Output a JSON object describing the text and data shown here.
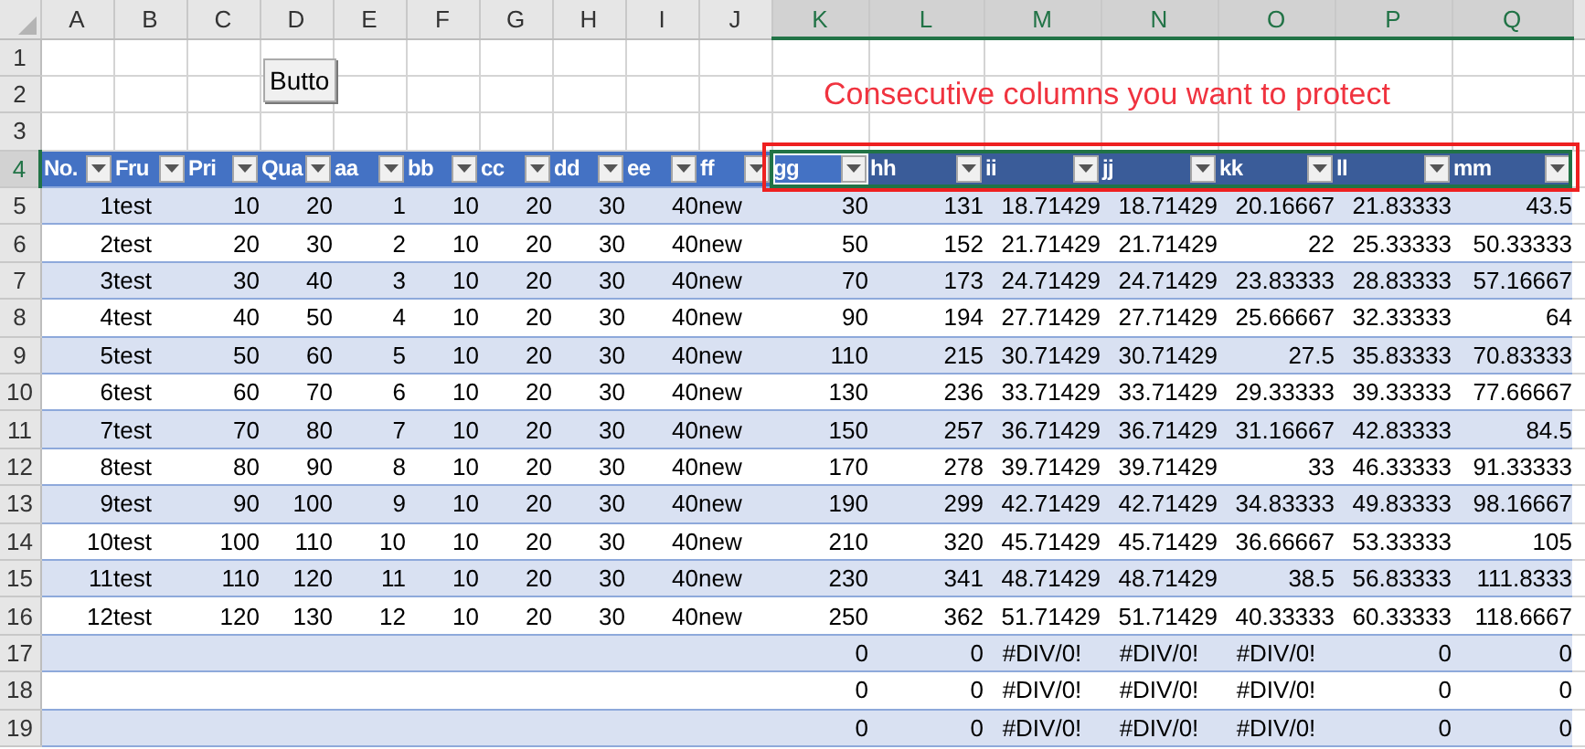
{
  "sheet": {
    "columns": [
      {
        "label": "A",
        "selected": false
      },
      {
        "label": "B",
        "selected": false
      },
      {
        "label": "C",
        "selected": false
      },
      {
        "label": "D",
        "selected": false
      },
      {
        "label": "E",
        "selected": false
      },
      {
        "label": "F",
        "selected": false
      },
      {
        "label": "G",
        "selected": false
      },
      {
        "label": "H",
        "selected": false
      },
      {
        "label": "I",
        "selected": false
      },
      {
        "label": "J",
        "selected": false
      },
      {
        "label": "K",
        "selected": true
      },
      {
        "label": "L",
        "selected": true
      },
      {
        "label": "M",
        "selected": true
      },
      {
        "label": "N",
        "selected": true
      },
      {
        "label": "O",
        "selected": true
      },
      {
        "label": "P",
        "selected": true
      },
      {
        "label": "Q",
        "selected": true
      }
    ],
    "row_headers": [
      {
        "label": "1",
        "selected": false
      },
      {
        "label": "2",
        "selected": false
      },
      {
        "label": "3",
        "selected": false
      },
      {
        "label": "4",
        "selected": true
      },
      {
        "label": "5",
        "selected": false
      },
      {
        "label": "6",
        "selected": false
      },
      {
        "label": "7",
        "selected": false
      },
      {
        "label": "8",
        "selected": false
      },
      {
        "label": "9",
        "selected": false
      },
      {
        "label": "10",
        "selected": false
      },
      {
        "label": "11",
        "selected": false
      },
      {
        "label": "12",
        "selected": false
      },
      {
        "label": "13",
        "selected": false
      },
      {
        "label": "14",
        "selected": false
      },
      {
        "label": "15",
        "selected": false
      },
      {
        "label": "16",
        "selected": false
      },
      {
        "label": "17",
        "selected": false
      },
      {
        "label": "18",
        "selected": false
      },
      {
        "label": "19",
        "selected": false
      }
    ],
    "button": {
      "label": "Butto"
    },
    "note": {
      "text": "Consecutive columns you want to protect"
    },
    "table": {
      "header": [
        {
          "label": "No.",
          "selected": false
        },
        {
          "label": "Fru",
          "selected": false
        },
        {
          "label": "Pri",
          "selected": false
        },
        {
          "label": "Qua",
          "selected": false
        },
        {
          "label": "aa",
          "selected": false
        },
        {
          "label": "bb",
          "selected": false
        },
        {
          "label": "cc",
          "selected": false
        },
        {
          "label": "dd",
          "selected": false
        },
        {
          "label": "ee",
          "selected": false
        },
        {
          "label": "ff",
          "selected": false
        },
        {
          "label": "gg",
          "selected": true
        },
        {
          "label": "hh",
          "selected": true
        },
        {
          "label": "ii",
          "selected": true
        },
        {
          "label": "jj",
          "selected": true
        },
        {
          "label": "kk",
          "selected": true
        },
        {
          "label": "ll",
          "selected": true
        },
        {
          "label": "mm",
          "selected": true
        }
      ],
      "rows": [
        [
          "1",
          "test",
          "10",
          "20",
          "1",
          "10",
          "20",
          "30",
          "40",
          "new",
          "30",
          "131",
          "18.71429",
          "18.71429",
          "20.16667",
          "21.83333",
          "43.5"
        ],
        [
          "2",
          "test",
          "20",
          "30",
          "2",
          "10",
          "20",
          "30",
          "40",
          "new",
          "50",
          "152",
          "21.71429",
          "21.71429",
          "22",
          "25.33333",
          "50.33333"
        ],
        [
          "3",
          "test",
          "30",
          "40",
          "3",
          "10",
          "20",
          "30",
          "40",
          "new",
          "70",
          "173",
          "24.71429",
          "24.71429",
          "23.83333",
          "28.83333",
          "57.16667"
        ],
        [
          "4",
          "test",
          "40",
          "50",
          "4",
          "10",
          "20",
          "30",
          "40",
          "new",
          "90",
          "194",
          "27.71429",
          "27.71429",
          "25.66667",
          "32.33333",
          "64"
        ],
        [
          "5",
          "test",
          "50",
          "60",
          "5",
          "10",
          "20",
          "30",
          "40",
          "new",
          "110",
          "215",
          "30.71429",
          "30.71429",
          "27.5",
          "35.83333",
          "70.83333"
        ],
        [
          "6",
          "test",
          "60",
          "70",
          "6",
          "10",
          "20",
          "30",
          "40",
          "new",
          "130",
          "236",
          "33.71429",
          "33.71429",
          "29.33333",
          "39.33333",
          "77.66667"
        ],
        [
          "7",
          "test",
          "70",
          "80",
          "7",
          "10",
          "20",
          "30",
          "40",
          "new",
          "150",
          "257",
          "36.71429",
          "36.71429",
          "31.16667",
          "42.83333",
          "84.5"
        ],
        [
          "8",
          "test",
          "80",
          "90",
          "8",
          "10",
          "20",
          "30",
          "40",
          "new",
          "170",
          "278",
          "39.71429",
          "39.71429",
          "33",
          "46.33333",
          "91.33333"
        ],
        [
          "9",
          "test",
          "90",
          "100",
          "9",
          "10",
          "20",
          "30",
          "40",
          "new",
          "190",
          "299",
          "42.71429",
          "42.71429",
          "34.83333",
          "49.83333",
          "98.16667"
        ],
        [
          "10",
          "test",
          "100",
          "110",
          "10",
          "10",
          "20",
          "30",
          "40",
          "new",
          "210",
          "320",
          "45.71429",
          "45.71429",
          "36.66667",
          "53.33333",
          "105"
        ],
        [
          "11",
          "test",
          "110",
          "120",
          "11",
          "10",
          "20",
          "30",
          "40",
          "new",
          "230",
          "341",
          "48.71429",
          "48.71429",
          "38.5",
          "56.83333",
          "111.8333"
        ],
        [
          "12",
          "test",
          "120",
          "130",
          "12",
          "10",
          "20",
          "30",
          "40",
          "new",
          "250",
          "362",
          "51.71429",
          "51.71429",
          "40.33333",
          "60.33333",
          "118.6667"
        ],
        [
          null,
          null,
          null,
          null,
          null,
          null,
          null,
          null,
          null,
          null,
          "0",
          "0",
          {
            "text": "#DIV/0!",
            "kind": "error"
          },
          {
            "text": "#DIV/0!",
            "kind": "error"
          },
          {
            "text": "#DIV/0!",
            "kind": "error"
          },
          "0",
          "0"
        ],
        [
          null,
          null,
          null,
          null,
          null,
          null,
          null,
          null,
          null,
          null,
          "0",
          "0",
          {
            "text": "#DIV/0!",
            "kind": "error"
          },
          {
            "text": "#DIV/0!",
            "kind": "error"
          },
          {
            "text": "#DIV/0!",
            "kind": "error"
          },
          "0",
          "0"
        ],
        [
          null,
          null,
          null,
          null,
          null,
          null,
          null,
          null,
          null,
          null,
          "0",
          "0",
          {
            "text": "#DIV/0!",
            "kind": "error"
          },
          {
            "text": "#DIV/0!",
            "kind": "error"
          },
          {
            "text": "#DIV/0!",
            "kind": "error"
          },
          "0",
          "0"
        ]
      ]
    }
  }
}
